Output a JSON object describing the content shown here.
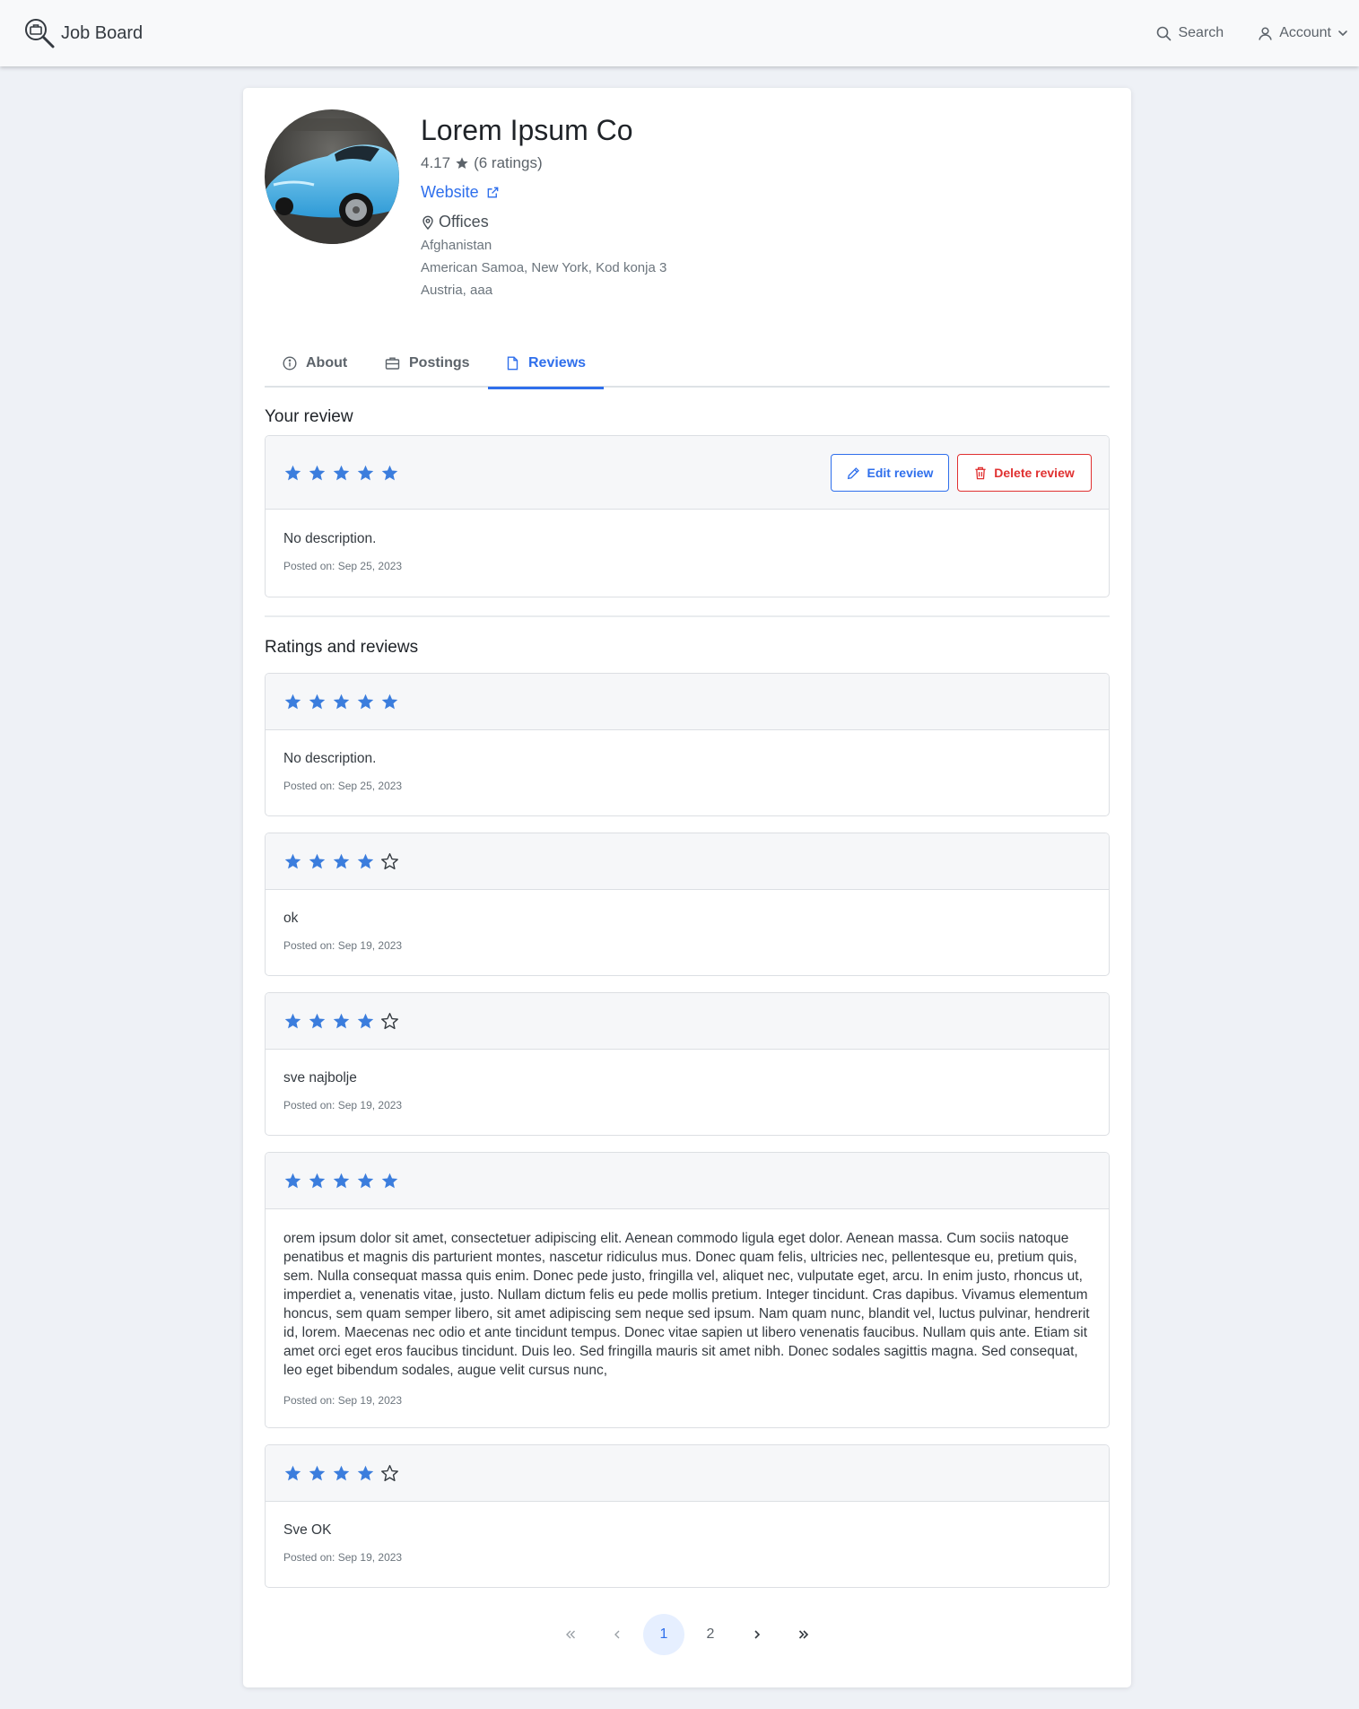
{
  "nav": {
    "brand": "Job Board",
    "search_label": "Search",
    "account_label": "Account"
  },
  "company": {
    "name": "Lorem Ipsum Co",
    "rating": "4.17",
    "ratings_count": "(6 ratings)",
    "website_label": "Website",
    "offices_label": "Offices",
    "offices": [
      "Afghanistan",
      "American Samoa, New York, Kod konja 3",
      "Austria, aaa"
    ]
  },
  "tabs": [
    {
      "label": "About",
      "icon": "info-icon"
    },
    {
      "label": "Postings",
      "icon": "briefcase-icon"
    },
    {
      "label": "Reviews",
      "icon": "document-icon",
      "active": true
    }
  ],
  "your_review": {
    "heading": "Your review",
    "stars": 5,
    "text": "No description.",
    "posted": "Posted on: Sep 25, 2023",
    "edit_label": "Edit review",
    "delete_label": "Delete review"
  },
  "reviews_heading": "Ratings and reviews",
  "reviews": [
    {
      "stars": 5,
      "text": "No description.",
      "posted": "Posted on: Sep 25, 2023"
    },
    {
      "stars": 4,
      "text": "ok",
      "posted": "Posted on: Sep 19, 2023"
    },
    {
      "stars": 4,
      "text": "sve najbolje",
      "posted": "Posted on: Sep 19, 2023"
    },
    {
      "stars": 5,
      "text": "orem ipsum dolor sit amet, consectetuer adipiscing elit. Aenean commodo ligula eget dolor. Aenean massa. Cum sociis natoque penatibus et magnis dis parturient montes, nascetur ridiculus mus. Donec quam felis, ultricies nec, pellentesque eu, pretium quis, sem. Nulla consequat massa quis enim. Donec pede justo, fringilla vel, aliquet nec, vulputate eget, arcu. In enim justo, rhoncus ut, imperdiet a, venenatis vitae, justo. Nullam dictum felis eu pede mollis pretium. Integer tincidunt. Cras dapibus. Vivamus elementum honcus, sem quam semper libero, sit amet adipiscing sem neque sed ipsum. Nam quam nunc, blandit vel, luctus pulvinar, hendrerit id, lorem. Maecenas nec odio et ante tincidunt tempus. Donec vitae sapien ut libero venenatis faucibus. Nullam quis ante. Etiam sit amet orci eget eros faucibus tincidunt. Duis leo. Sed fringilla mauris sit amet nibh. Donec sodales sagittis magna. Sed consequat, leo eget bibendum sodales, augue velit cursus nunc,",
      "posted": "Posted on: Sep 19, 2023"
    },
    {
      "stars": 4,
      "text": "Sve OK",
      "posted": "Posted on: Sep 19, 2023"
    }
  ],
  "pagination": {
    "pages": [
      "1",
      "2"
    ],
    "current": "1"
  },
  "colors": {
    "accent": "#2f6fec",
    "danger": "#e03131",
    "star": "#3b7ddd"
  }
}
